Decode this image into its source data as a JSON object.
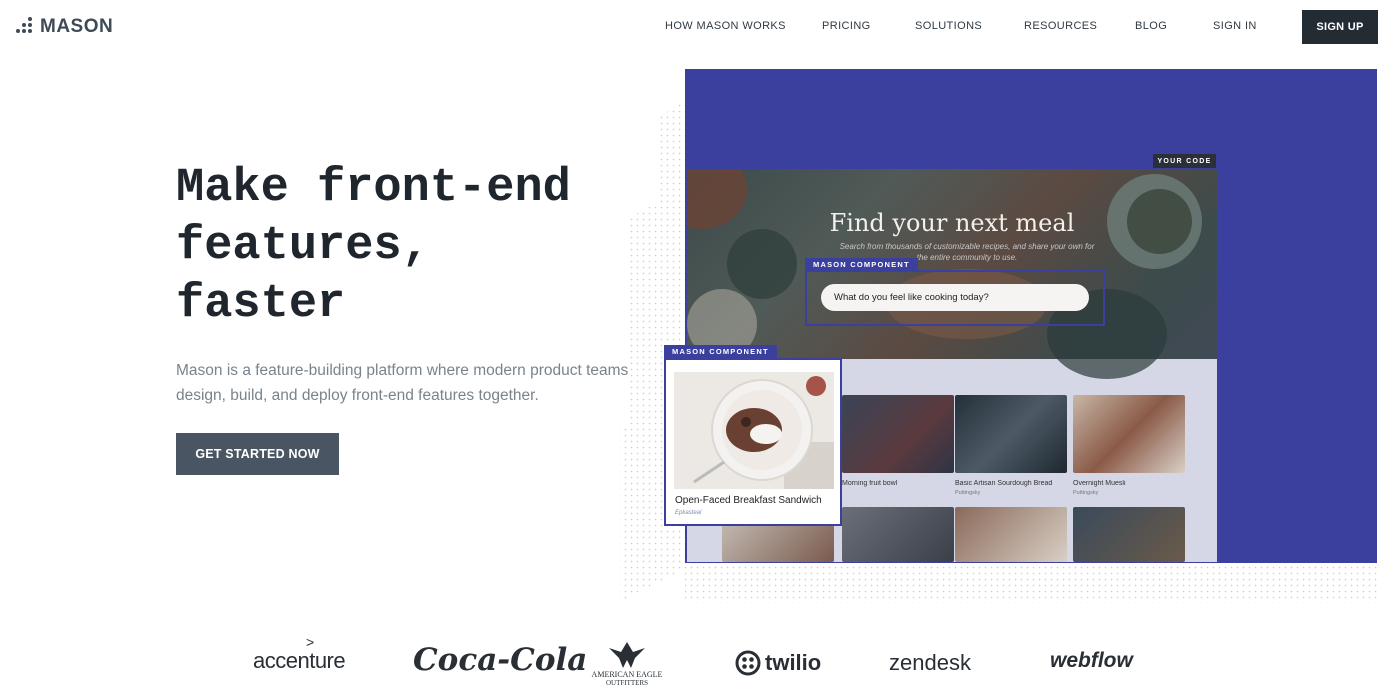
{
  "brand": {
    "name": "MASON"
  },
  "nav": {
    "links": [
      "HOW MASON WORKS",
      "PRICING",
      "SOLUTIONS",
      "RESOURCES",
      "BLOG",
      "SIGN IN"
    ],
    "signup_label": "SIGN UP"
  },
  "hero": {
    "title": [
      "Make front-end",
      "features,",
      "faster"
    ],
    "subtitle_line1": "Mason is a feature-building platform where modern product teams",
    "subtitle_line2": "design, build, and deploy front-end features together.",
    "cta_label": "GET STARTED NOW"
  },
  "mockup": {
    "your_code_tag": "YOUR CODE",
    "component_tag": "MASON COMPONENT",
    "screen_title": "Find your next meal",
    "screen_desc": "Search from thousands of customizable recipes, and share your own for the entire community to use.",
    "search_placeholder": "What do you feel like cooking today?",
    "feature_card": {
      "title": "Open-Faced Breakfast Sandwich",
      "author": "Epkasteal"
    },
    "cards": [
      {
        "title": "Morning fruit bowl",
        "author": ""
      },
      {
        "title": "Basic Artisan Sourdough Bread",
        "author": "Puttingsky"
      },
      {
        "title": "Overnight Muesli",
        "author": "Puttingsky"
      }
    ]
  },
  "client_logos": [
    "accenture",
    "Coca-Cola",
    "AMERICAN EAGLE",
    "OUTFITTERS",
    "twilio",
    "zendesk",
    "webflow"
  ],
  "colors": {
    "accent": "#3b3f9e",
    "dark": "#232b33",
    "cta": "#4a5563"
  }
}
